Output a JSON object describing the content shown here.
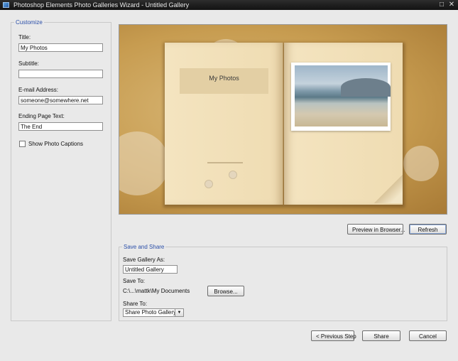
{
  "window": {
    "title": "Photoshop Elements Photo Galleries Wizard - Untitled Gallery",
    "controls": [
      "□",
      "✕"
    ]
  },
  "customize": {
    "legend": "Customize",
    "title_label": "Title:",
    "title_value": "My Photos",
    "subtitle_label": "Subtitle:",
    "subtitle_value": "",
    "email_label": "E-mail Address:",
    "email_value": "someone@somewhere.net",
    "ending_label": "Ending Page Text:",
    "ending_value": "The End",
    "captions_label": "Show Photo Captions",
    "captions_checked": false
  },
  "preview": {
    "book_title": "My Photos",
    "preview_browser_label": "Preview in Browser...",
    "refresh_label": "Refresh"
  },
  "save_share": {
    "legend": "Save and Share",
    "save_as_label": "Save Gallery As:",
    "save_as_value": "Untitled Gallery",
    "save_to_label": "Save To:",
    "save_to_value": "C:\\...\\mattk\\My Documents",
    "browse_label": "Browse...",
    "share_to_label": "Share To:",
    "share_to_value": "Share Photo Gallery"
  },
  "footer": {
    "previous_label": "< Previous Step",
    "share_label": "Share",
    "cancel_label": "Cancel"
  },
  "icons": {
    "app": "photoshop-elements-icon",
    "maximize": "maximize-icon",
    "close": "close-icon",
    "dropdown": "chevron-down-icon"
  }
}
